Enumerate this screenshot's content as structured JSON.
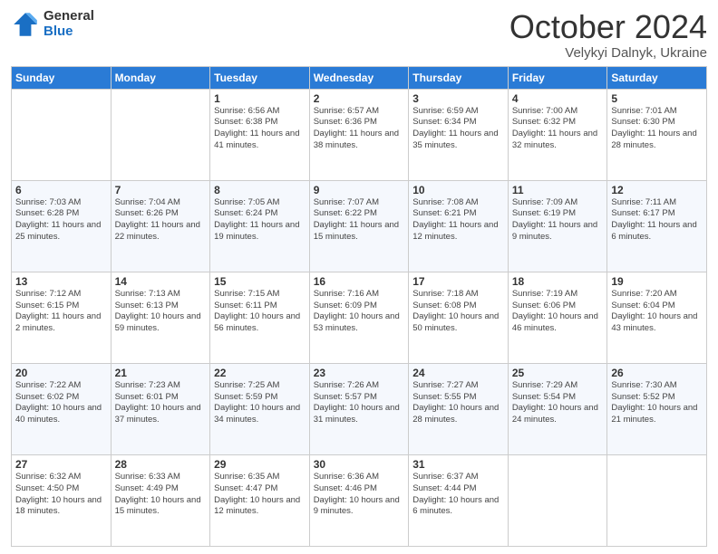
{
  "logo": {
    "general": "General",
    "blue": "Blue"
  },
  "header": {
    "month": "October 2024",
    "location": "Velykyi Dalnyk, Ukraine"
  },
  "weekdays": [
    "Sunday",
    "Monday",
    "Tuesday",
    "Wednesday",
    "Thursday",
    "Friday",
    "Saturday"
  ],
  "weeks": [
    [
      {
        "day": "",
        "info": ""
      },
      {
        "day": "",
        "info": ""
      },
      {
        "day": "1",
        "info": "Sunrise: 6:56 AM\nSunset: 6:38 PM\nDaylight: 11 hours and 41 minutes."
      },
      {
        "day": "2",
        "info": "Sunrise: 6:57 AM\nSunset: 6:36 PM\nDaylight: 11 hours and 38 minutes."
      },
      {
        "day": "3",
        "info": "Sunrise: 6:59 AM\nSunset: 6:34 PM\nDaylight: 11 hours and 35 minutes."
      },
      {
        "day": "4",
        "info": "Sunrise: 7:00 AM\nSunset: 6:32 PM\nDaylight: 11 hours and 32 minutes."
      },
      {
        "day": "5",
        "info": "Sunrise: 7:01 AM\nSunset: 6:30 PM\nDaylight: 11 hours and 28 minutes."
      }
    ],
    [
      {
        "day": "6",
        "info": "Sunrise: 7:03 AM\nSunset: 6:28 PM\nDaylight: 11 hours and 25 minutes."
      },
      {
        "day": "7",
        "info": "Sunrise: 7:04 AM\nSunset: 6:26 PM\nDaylight: 11 hours and 22 minutes."
      },
      {
        "day": "8",
        "info": "Sunrise: 7:05 AM\nSunset: 6:24 PM\nDaylight: 11 hours and 19 minutes."
      },
      {
        "day": "9",
        "info": "Sunrise: 7:07 AM\nSunset: 6:22 PM\nDaylight: 11 hours and 15 minutes."
      },
      {
        "day": "10",
        "info": "Sunrise: 7:08 AM\nSunset: 6:21 PM\nDaylight: 11 hours and 12 minutes."
      },
      {
        "day": "11",
        "info": "Sunrise: 7:09 AM\nSunset: 6:19 PM\nDaylight: 11 hours and 9 minutes."
      },
      {
        "day": "12",
        "info": "Sunrise: 7:11 AM\nSunset: 6:17 PM\nDaylight: 11 hours and 6 minutes."
      }
    ],
    [
      {
        "day": "13",
        "info": "Sunrise: 7:12 AM\nSunset: 6:15 PM\nDaylight: 11 hours and 2 minutes."
      },
      {
        "day": "14",
        "info": "Sunrise: 7:13 AM\nSunset: 6:13 PM\nDaylight: 10 hours and 59 minutes."
      },
      {
        "day": "15",
        "info": "Sunrise: 7:15 AM\nSunset: 6:11 PM\nDaylight: 10 hours and 56 minutes."
      },
      {
        "day": "16",
        "info": "Sunrise: 7:16 AM\nSunset: 6:09 PM\nDaylight: 10 hours and 53 minutes."
      },
      {
        "day": "17",
        "info": "Sunrise: 7:18 AM\nSunset: 6:08 PM\nDaylight: 10 hours and 50 minutes."
      },
      {
        "day": "18",
        "info": "Sunrise: 7:19 AM\nSunset: 6:06 PM\nDaylight: 10 hours and 46 minutes."
      },
      {
        "day": "19",
        "info": "Sunrise: 7:20 AM\nSunset: 6:04 PM\nDaylight: 10 hours and 43 minutes."
      }
    ],
    [
      {
        "day": "20",
        "info": "Sunrise: 7:22 AM\nSunset: 6:02 PM\nDaylight: 10 hours and 40 minutes."
      },
      {
        "day": "21",
        "info": "Sunrise: 7:23 AM\nSunset: 6:01 PM\nDaylight: 10 hours and 37 minutes."
      },
      {
        "day": "22",
        "info": "Sunrise: 7:25 AM\nSunset: 5:59 PM\nDaylight: 10 hours and 34 minutes."
      },
      {
        "day": "23",
        "info": "Sunrise: 7:26 AM\nSunset: 5:57 PM\nDaylight: 10 hours and 31 minutes."
      },
      {
        "day": "24",
        "info": "Sunrise: 7:27 AM\nSunset: 5:55 PM\nDaylight: 10 hours and 28 minutes."
      },
      {
        "day": "25",
        "info": "Sunrise: 7:29 AM\nSunset: 5:54 PM\nDaylight: 10 hours and 24 minutes."
      },
      {
        "day": "26",
        "info": "Sunrise: 7:30 AM\nSunset: 5:52 PM\nDaylight: 10 hours and 21 minutes."
      }
    ],
    [
      {
        "day": "27",
        "info": "Sunrise: 6:32 AM\nSunset: 4:50 PM\nDaylight: 10 hours and 18 minutes."
      },
      {
        "day": "28",
        "info": "Sunrise: 6:33 AM\nSunset: 4:49 PM\nDaylight: 10 hours and 15 minutes."
      },
      {
        "day": "29",
        "info": "Sunrise: 6:35 AM\nSunset: 4:47 PM\nDaylight: 10 hours and 12 minutes."
      },
      {
        "day": "30",
        "info": "Sunrise: 6:36 AM\nSunset: 4:46 PM\nDaylight: 10 hours and 9 minutes."
      },
      {
        "day": "31",
        "info": "Sunrise: 6:37 AM\nSunset: 4:44 PM\nDaylight: 10 hours and 6 minutes."
      },
      {
        "day": "",
        "info": ""
      },
      {
        "day": "",
        "info": ""
      }
    ]
  ]
}
